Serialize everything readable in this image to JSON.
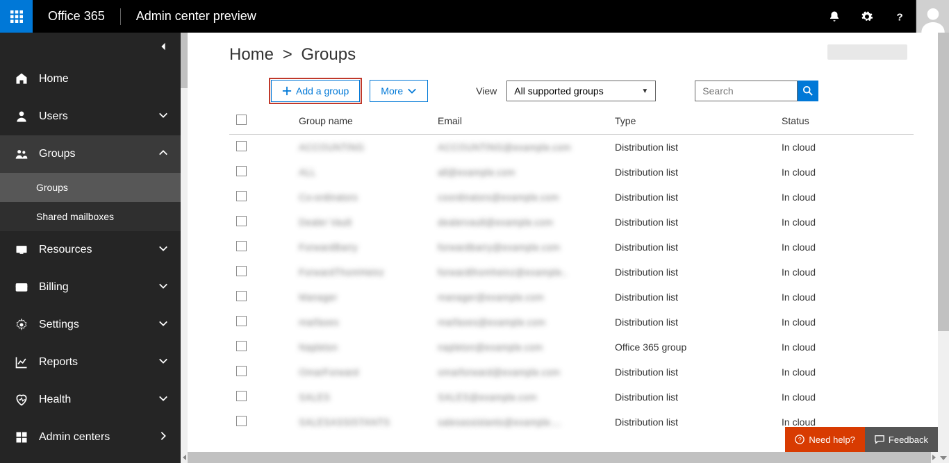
{
  "top": {
    "brand": "Office 365",
    "product": "Admin center preview"
  },
  "sidebar": {
    "items": [
      {
        "label": "Home",
        "icon": "home",
        "expand": null
      },
      {
        "label": "Users",
        "icon": "user",
        "expand": "down"
      },
      {
        "label": "Groups",
        "icon": "groups",
        "expand": "up",
        "active": true,
        "sub": [
          {
            "label": "Groups",
            "active": true
          },
          {
            "label": "Shared mailboxes"
          }
        ]
      },
      {
        "label": "Resources",
        "icon": "resources",
        "expand": "down"
      },
      {
        "label": "Billing",
        "icon": "billing",
        "expand": "down"
      },
      {
        "label": "Settings",
        "icon": "settings",
        "expand": "down"
      },
      {
        "label": "Reports",
        "icon": "reports",
        "expand": "down"
      },
      {
        "label": "Health",
        "icon": "health",
        "expand": "down"
      },
      {
        "label": "Admin centers",
        "icon": "admincenters",
        "expand": "right"
      }
    ]
  },
  "breadcrumb": {
    "root": "Home",
    "current": "Groups"
  },
  "toolbar": {
    "add_label": "Add a group",
    "more_label": "More",
    "view_label": "View",
    "view_value": "All supported groups",
    "search_placeholder": "Search"
  },
  "table": {
    "columns": [
      "",
      "Group name",
      "Email",
      "Type",
      "Status"
    ],
    "rows": [
      {
        "name": "ACCOUNTING",
        "email": "ACCOUNTING@example.com",
        "type": "Distribution list",
        "status": "In cloud"
      },
      {
        "name": "ALL",
        "email": "all@example.com",
        "type": "Distribution list",
        "status": "In cloud"
      },
      {
        "name": "Co-ordinators",
        "email": "coordinators@example.com",
        "type": "Distribution list",
        "status": "In cloud"
      },
      {
        "name": "Dealer Vault",
        "email": "dealervault@example.com",
        "type": "Distribution list",
        "status": "In cloud"
      },
      {
        "name": "ForwardBarry",
        "email": "forwardbarry@example.com",
        "type": "Distribution list",
        "status": "In cloud"
      },
      {
        "name": "ForwardThomHeinz",
        "email": "forwardthomheinz@example..",
        "type": "Distribution list",
        "status": "In cloud"
      },
      {
        "name": "Manager",
        "email": "manager@example.com",
        "type": "Distribution list",
        "status": "In cloud"
      },
      {
        "name": "marfaxes",
        "email": "marfaxes@example.com",
        "type": "Distribution list",
        "status": "In cloud"
      },
      {
        "name": "Napleton",
        "email": "napleton@example.com",
        "type": "Office 365 group",
        "status": "In cloud"
      },
      {
        "name": "OmarForward",
        "email": "omarforward@example.com",
        "type": "Distribution list",
        "status": "In cloud"
      },
      {
        "name": "SALES",
        "email": "SALES@example.com",
        "type": "Distribution list",
        "status": "In cloud"
      },
      {
        "name": "SALESASSISTANTS",
        "email": "salesassistants@example....",
        "type": "Distribution list",
        "status": "In cloud"
      }
    ]
  },
  "footer": {
    "help": "Need help?",
    "feedback": "Feedback"
  }
}
